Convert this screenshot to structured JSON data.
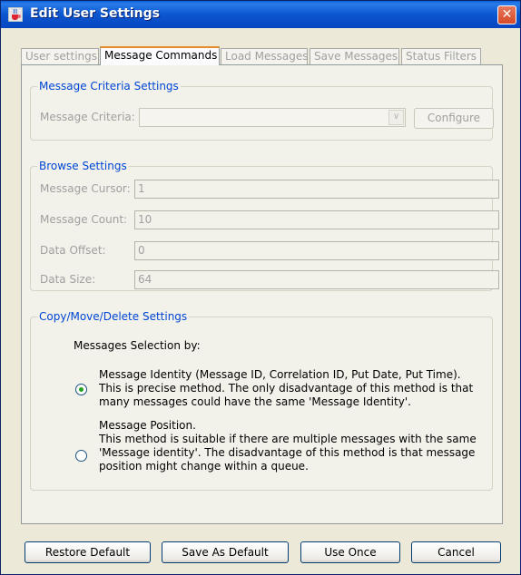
{
  "window": {
    "title": "Edit User Settings",
    "close_symbol": "✕"
  },
  "tabs": [
    {
      "label": "User settings",
      "active": false,
      "enabled": false
    },
    {
      "label": "Message Commands",
      "active": true,
      "enabled": true
    },
    {
      "label": "Load Messages",
      "active": false,
      "enabled": false
    },
    {
      "label": "Save Messages",
      "active": false,
      "enabled": false
    },
    {
      "label": "Status Filters",
      "active": false,
      "enabled": false
    }
  ],
  "criteria": {
    "legend": "Message Criteria Settings",
    "label": "Message Criteria:",
    "value": "",
    "configure_label": "Configure"
  },
  "browse": {
    "legend": "Browse Settings",
    "fields": [
      {
        "label": "Message Cursor:",
        "value": "1"
      },
      {
        "label": "Message Count:",
        "value": "10"
      },
      {
        "label": "Data Offset:",
        "value": "0"
      },
      {
        "label": "Data Size:",
        "value": "64"
      }
    ]
  },
  "copy": {
    "legend": "Copy/Move/Delete Settings",
    "selection_label": "Messages Selection by:",
    "options": [
      {
        "selected": true,
        "lines": [
          "Message Identity (Message ID, Correlation ID, Put Date, Put Time).",
          "This is precise method. The only disadvantage of this method is that",
          "many messages could have the same 'Message Identity'."
        ]
      },
      {
        "selected": false,
        "lines": [
          "Message Position.",
          "This method is suitable if there are multiple messages with the same",
          "'Message identity'. The disadvantage of this method is that message",
          "position might change within a queue."
        ]
      }
    ]
  },
  "buttons": {
    "restore": "Restore Default",
    "save": "Save As Default",
    "use_once": "Use Once",
    "cancel": "Cancel"
  },
  "colors": {
    "accent": "#0046d5",
    "title_bar": "#0b56d0",
    "radio_dot": "#21a121",
    "tab_highlight": "#e68b2c"
  }
}
